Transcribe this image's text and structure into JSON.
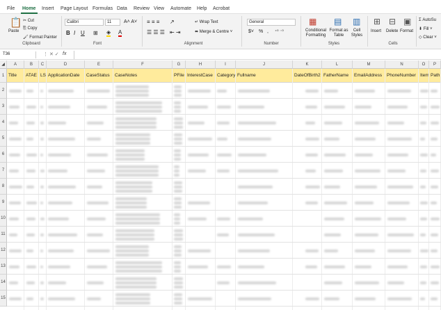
{
  "tabs": [
    "File",
    "Home",
    "Insert",
    "Page Layout",
    "Formulas",
    "Data",
    "Review",
    "View",
    "Automate",
    "Help",
    "Acrobat"
  ],
  "active_tab": "Home",
  "clipboard": {
    "paste": "Paste",
    "cut": "Cut",
    "copy": "Copy",
    "format_painter": "Format Painter",
    "group": "Clipboard"
  },
  "font": {
    "name": "Calibri",
    "size": "11",
    "group": "Font"
  },
  "alignment": {
    "wrap": "Wrap Text",
    "merge": "Merge & Centre",
    "group": "Alignment"
  },
  "number": {
    "format": "General",
    "group": "Number",
    "percent": "%",
    "comma": ","
  },
  "styles": {
    "conditional": "Conditional Formatting",
    "format_table": "Format as Table",
    "cell_styles": "Cell Styles",
    "group": "Styles"
  },
  "cells": {
    "insert": "Insert",
    "delete": "Delete",
    "format": "Format",
    "group": "Cells"
  },
  "editing": {
    "autosum": "AutoSu",
    "fill": "Fill",
    "clear": "Clear"
  },
  "name_box": "T36",
  "fx": "fx",
  "columns": [
    "A",
    "B",
    "C",
    "D",
    "E",
    "F",
    "G",
    "H",
    "I",
    "J",
    "K",
    "L",
    "M",
    "N",
    "O",
    "P"
  ],
  "headers": [
    "Title",
    "ATAE",
    "LSU",
    "ApplicationDate",
    "CaseStatus",
    "CaseNotes",
    "PFile",
    "InterestCase",
    "Category",
    "Fullname",
    "DateOfBirth2",
    "FatherName",
    "EmailAddress",
    "PhoneNumber",
    "Item",
    "Path"
  ],
  "rows": [
    "1",
    "2",
    "3",
    "4",
    "5",
    "6",
    "7",
    "8",
    "9",
    "10",
    "11",
    "12",
    "13",
    "14",
    "15"
  ]
}
